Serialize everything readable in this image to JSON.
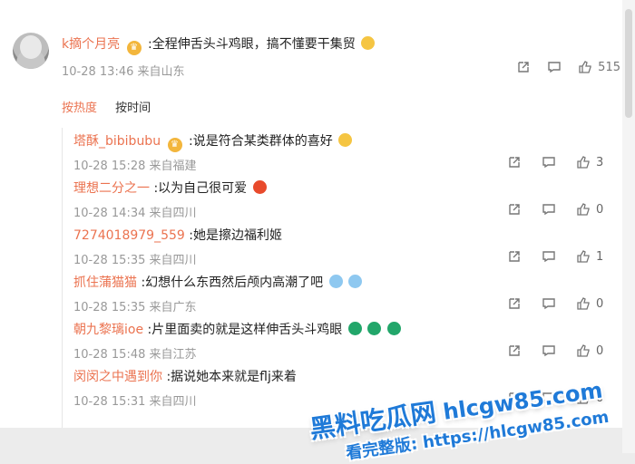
{
  "main": {
    "user_name": "k摘个月亮",
    "text": ":全程伸舌头斗鸡眼，搞不懂要干集贸",
    "meta": "10-28 13:46 来自山东",
    "likes": "515"
  },
  "sort": {
    "hot": "按热度",
    "time": "按时间"
  },
  "replies": [
    {
      "user": "塔酥_bibibubu",
      "text": ":说是符合某类群体的喜好",
      "meta": "10-28 15:28 来自福建",
      "likes": "3"
    },
    {
      "user": "理想二分之一",
      "text": ":以为自己很可爱",
      "meta": "10-28 14:34 来自四川",
      "likes": "0"
    },
    {
      "user": "7274018979_559",
      "text": ":她是擦边福利姬",
      "meta": "10-28 15:35 来自四川",
      "likes": "1"
    },
    {
      "user": "抓住蒲猫猫",
      "text": ":幻想什么东西然后颅内高潮了吧",
      "meta": "10-28 15:35 来自广东",
      "likes": "0"
    },
    {
      "user": "朝九黎璃ioe",
      "text": ":片里面卖的就是这样伸舌头斗鸡眼",
      "meta": "10-28 15:48 来自江苏",
      "likes": "0"
    },
    {
      "user": "闵闵之中遇到你",
      "text": ":据说她本来就是flj来着",
      "meta": "10-28 15:31 来自四川",
      "likes": "0"
    }
  ],
  "watermark": {
    "title": "黑料吃瓜网",
    "site": "hlcgw85.com",
    "footer": "看完整版: https://hlcgw85.com"
  }
}
